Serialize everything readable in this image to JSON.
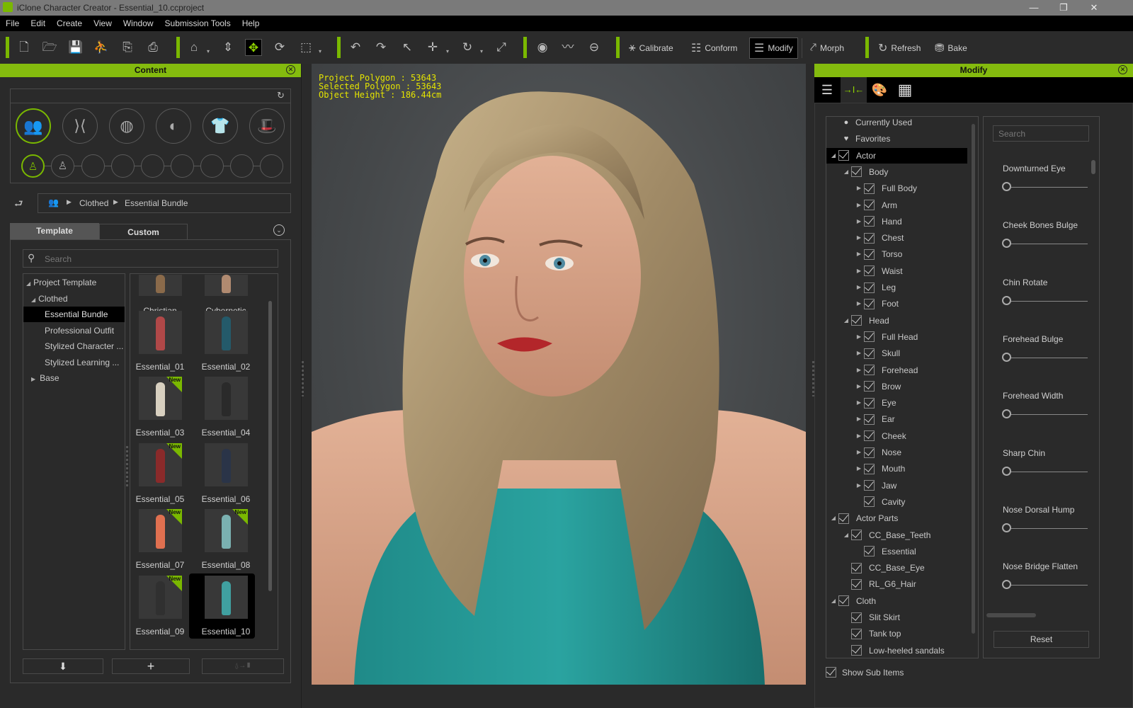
{
  "window": {
    "title": "iClone Character Creator - Essential_10.ccproject",
    "minimize": "—",
    "restore": "❐",
    "close": "✕"
  },
  "menu": [
    "File",
    "Edit",
    "Create",
    "View",
    "Window",
    "Submission Tools",
    "Help"
  ],
  "toolbar": {
    "icons": {
      "new": "🗋",
      "open": "🗁",
      "save": "💾",
      "export_char": "⛹",
      "import": "⎘",
      "export": "⎙",
      "home": "⌂",
      "fit": "⇕",
      "move_view": "✥",
      "orbit": "⟳",
      "frame": "⬚",
      "undo": "↶",
      "redo": "↷",
      "select": "↖",
      "move": "✛",
      "rotate": "↻",
      "scale": "⤢",
      "eye": "◉",
      "mask": "〰",
      "half": "⊖"
    },
    "calibrate": "Calibrate",
    "conform": "Conform",
    "modify": "Modify",
    "morph": "Morph",
    "refresh": "Refresh",
    "bake": "Bake"
  },
  "content_panel": {
    "title": "Content",
    "breadcrumb": [
      "Clothed",
      "Essential Bundle"
    ],
    "tabs": [
      {
        "label": "Template",
        "active": true
      },
      {
        "label": "Custom",
        "active": false
      }
    ],
    "search_placeholder": "Search",
    "tree": [
      {
        "label": "Project Template",
        "level": 0,
        "expanded": true
      },
      {
        "label": "Clothed",
        "level": 1,
        "expanded": true
      },
      {
        "label": "Essential Bundle",
        "level": 2,
        "selected": true
      },
      {
        "label": "Professional Outfit",
        "level": 2
      },
      {
        "label": "Stylized Character ...",
        "level": 2
      },
      {
        "label": "Stylized Learning ...",
        "level": 2
      },
      {
        "label": "Base",
        "level": 1,
        "expanded": false
      }
    ],
    "items": [
      {
        "label": "Christian",
        "new": false
      },
      {
        "label": "Cybernetic",
        "new": false
      },
      {
        "label": "Essential_01",
        "new": false
      },
      {
        "label": "Essential_02",
        "new": false
      },
      {
        "label": "Essential_03",
        "new": true
      },
      {
        "label": "Essential_04",
        "new": false
      },
      {
        "label": "Essential_05",
        "new": true
      },
      {
        "label": "Essential_06",
        "new": false
      },
      {
        "label": "Essential_07",
        "new": true
      },
      {
        "label": "Essential_08",
        "new": true
      },
      {
        "label": "Essential_09",
        "new": true
      },
      {
        "label": "Essential_10",
        "new": false,
        "selected": true
      }
    ],
    "new_badge": "New",
    "buttons": {
      "apply": "⬇",
      "add": "+",
      "replace": "⍙→▮"
    }
  },
  "viewport": {
    "project_polygon": "Project Polygon : 53643",
    "selected_polygon": "Selected Polygon : 53643",
    "object_height": "Object Height : 186.44cm"
  },
  "modify_panel": {
    "title": "Modify",
    "tabs": [
      "☰",
      "→I←",
      "🎨",
      "▦"
    ],
    "tree": [
      {
        "label": "Currently Used",
        "icon": "●",
        "level": 0
      },
      {
        "label": "Favorites",
        "icon": "♥",
        "level": 0
      },
      {
        "label": "Actor",
        "level": 0,
        "expanded": true,
        "selected": true
      },
      {
        "label": "Body",
        "level": 1,
        "expanded": true
      },
      {
        "label": "Full Body",
        "level": 2,
        "collapsed": true
      },
      {
        "label": "Arm",
        "level": 2,
        "collapsed": true
      },
      {
        "label": "Hand",
        "level": 2,
        "collapsed": true
      },
      {
        "label": "Chest",
        "level": 2,
        "collapsed": true
      },
      {
        "label": "Torso",
        "level": 2,
        "collapsed": true
      },
      {
        "label": "Waist",
        "level": 2,
        "collapsed": true
      },
      {
        "label": "Leg",
        "level": 2,
        "collapsed": true
      },
      {
        "label": "Foot",
        "level": 2,
        "collapsed": true
      },
      {
        "label": "Head",
        "level": 1,
        "expanded": true
      },
      {
        "label": "Full Head",
        "level": 2,
        "collapsed": true
      },
      {
        "label": "Skull",
        "level": 2,
        "collapsed": true
      },
      {
        "label": "Forehead",
        "level": 2,
        "collapsed": true
      },
      {
        "label": "Brow",
        "level": 2,
        "collapsed": true
      },
      {
        "label": "Eye",
        "level": 2,
        "collapsed": true
      },
      {
        "label": "Ear",
        "level": 2,
        "collapsed": true
      },
      {
        "label": "Cheek",
        "level": 2,
        "collapsed": true
      },
      {
        "label": "Nose",
        "level": 2,
        "collapsed": true
      },
      {
        "label": "Mouth",
        "level": 2,
        "collapsed": true
      },
      {
        "label": "Jaw",
        "level": 2,
        "collapsed": true
      },
      {
        "label": "Cavity",
        "level": 2
      },
      {
        "label": "Actor Parts",
        "level": 0,
        "expanded": true
      },
      {
        "label": "CC_Base_Teeth",
        "level": 1,
        "expanded": true
      },
      {
        "label": "Essential",
        "level": 2
      },
      {
        "label": "CC_Base_Eye",
        "level": 1
      },
      {
        "label": "RL_G6_Hair",
        "level": 1
      },
      {
        "label": "Cloth",
        "level": 0,
        "expanded": true
      },
      {
        "label": "Slit Skirt",
        "level": 1
      },
      {
        "label": "Tank top",
        "level": 1
      },
      {
        "label": "Low-heeled sandals",
        "level": 1
      }
    ],
    "show_sub_items": "Show Sub Items",
    "search_placeholder": "Search",
    "sliders": [
      {
        "label": "Downturned Eye",
        "value": 0
      },
      {
        "label": "Cheek Bones Bulge",
        "value": 0
      },
      {
        "label": "Chin Rotate",
        "value": 0
      },
      {
        "label": "Forehead Bulge",
        "value": 0
      },
      {
        "label": "Forehead Width",
        "value": 0
      },
      {
        "label": "Sharp Chin",
        "value": 0
      },
      {
        "label": "Nose Dorsal Hump",
        "value": 0
      },
      {
        "label": "Nose Bridge Flatten",
        "value": 0
      }
    ],
    "reset": "Reset"
  },
  "colors": {
    "accent": "#84bb0e",
    "info_text": "#e4e400"
  }
}
